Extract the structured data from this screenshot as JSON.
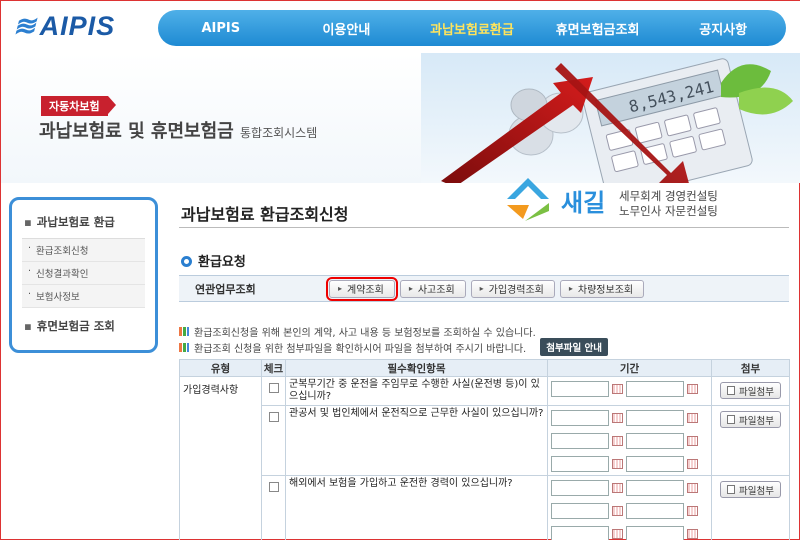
{
  "logo": {
    "text": "AIPIS"
  },
  "nav": {
    "items": [
      "AIPIS",
      "이용안내",
      "과납보험료환급",
      "휴면보험금조회",
      "공지사항"
    ],
    "active_index": 2
  },
  "banner": {
    "badge": "자동차보험",
    "title": "과납보험료 및 휴면보험금",
    "subtitle": "통합조회시스템",
    "calculator_display": "8,543,241"
  },
  "sidebar": {
    "group1": "과납보험료 환급",
    "items": [
      "환급조회신청",
      "신청결과확인",
      "보험사정보"
    ],
    "group2": "휴면보험금 조회"
  },
  "page_title": "과납보험료 환급조회신청",
  "brand": {
    "name": "새길",
    "line1": "세무회계 경영컨설팅",
    "line2": "노무인사 자문컨설팅"
  },
  "section_title": "환급요청",
  "related": {
    "label": "연관업무조회",
    "buttons": [
      "계약조회",
      "사고조회",
      "가입경력조회",
      "차량정보조회"
    ],
    "highlighted_index": 0
  },
  "notes": {
    "line1": "환급조회신청을 위해 본인의 계약, 사고 내용 등 보험정보를 조회하실 수 있습니다.",
    "line2": "환급조회 신청을 위한 첨부파일을 확인하시어 파일을 첨부하여 주시기 바랍니다.",
    "attach_guide_btn": "첨부파일 안내"
  },
  "table": {
    "headers": [
      "유형",
      "체크",
      "필수확인항목",
      "기간",
      "첨부"
    ],
    "type_label": "가입경력사항",
    "rows": [
      {
        "question": "군복무기간 중 운전을 주임무로 수행한 사실(운전병 등)이 있으십니까?",
        "date_rows": 1
      },
      {
        "question": "관공서 및 법인체에서 운전직으로 근무한 사실이 있으십니까?",
        "date_rows": 3
      },
      {
        "question": "해외에서 보험을 가입하고 운전한 경력이 있으십니까?",
        "date_rows": 3
      }
    ],
    "attach_label": "파일첨부"
  },
  "colors": {
    "nav_blue": "#1e8ad3",
    "accent_red": "#c8212e",
    "highlight": "#ee0000"
  }
}
